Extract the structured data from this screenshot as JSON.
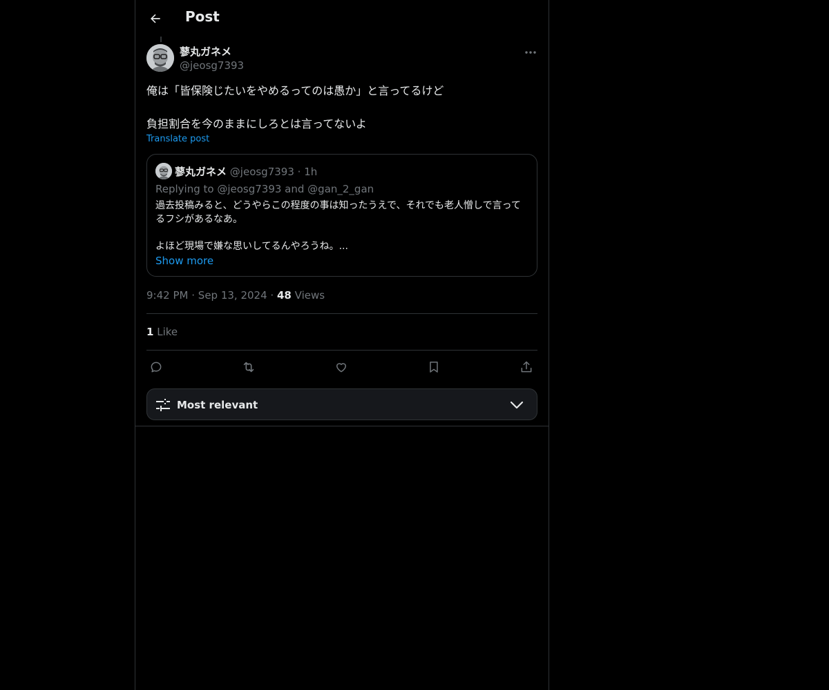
{
  "header": {
    "title": "Post",
    "back_icon": "arrow-left-icon"
  },
  "post": {
    "author_name": "蓼丸ガネメ",
    "author_handle": "@jeosg7393",
    "text_lines": [
      "俺は「皆保険じたいをやめるってのは愚か」と言ってるけど",
      "負担割合を今のままにしろとは言ってないよ"
    ],
    "translate_label": "Translate post",
    "time": "9:42 PM",
    "separator": "·",
    "date": "Sep 13, 2024",
    "views_count": "48",
    "views_label": "Views",
    "likes_count": "1",
    "likes_label": "Like"
  },
  "quote": {
    "author_name": "蓼丸ガネメ",
    "author_handle": "@jeosg7393",
    "separator": "·",
    "time": "1h",
    "replying_to": "Replying to @jeosg7393 and @gan_2_gan",
    "text_lines": [
      "過去投稿みると、どうやらこの程度の事は知ったうえで、それでも老人憎しで言ってるフシがあるなあ。",
      "よほど現場で嫌な思いしてるんやろうね。..."
    ],
    "show_more_label": "Show more"
  },
  "actions": {
    "icons": [
      "reply-icon",
      "retweet-icon",
      "like-icon",
      "bookmark-icon",
      "share-icon"
    ]
  },
  "sort": {
    "label": "Most relevant",
    "icon": "sliders-icon",
    "chevron": "chevron-down-icon"
  },
  "colors": {
    "accent": "#1d9bf0",
    "background": "#000000",
    "muted": "#71767b",
    "border": "#2f3336"
  }
}
